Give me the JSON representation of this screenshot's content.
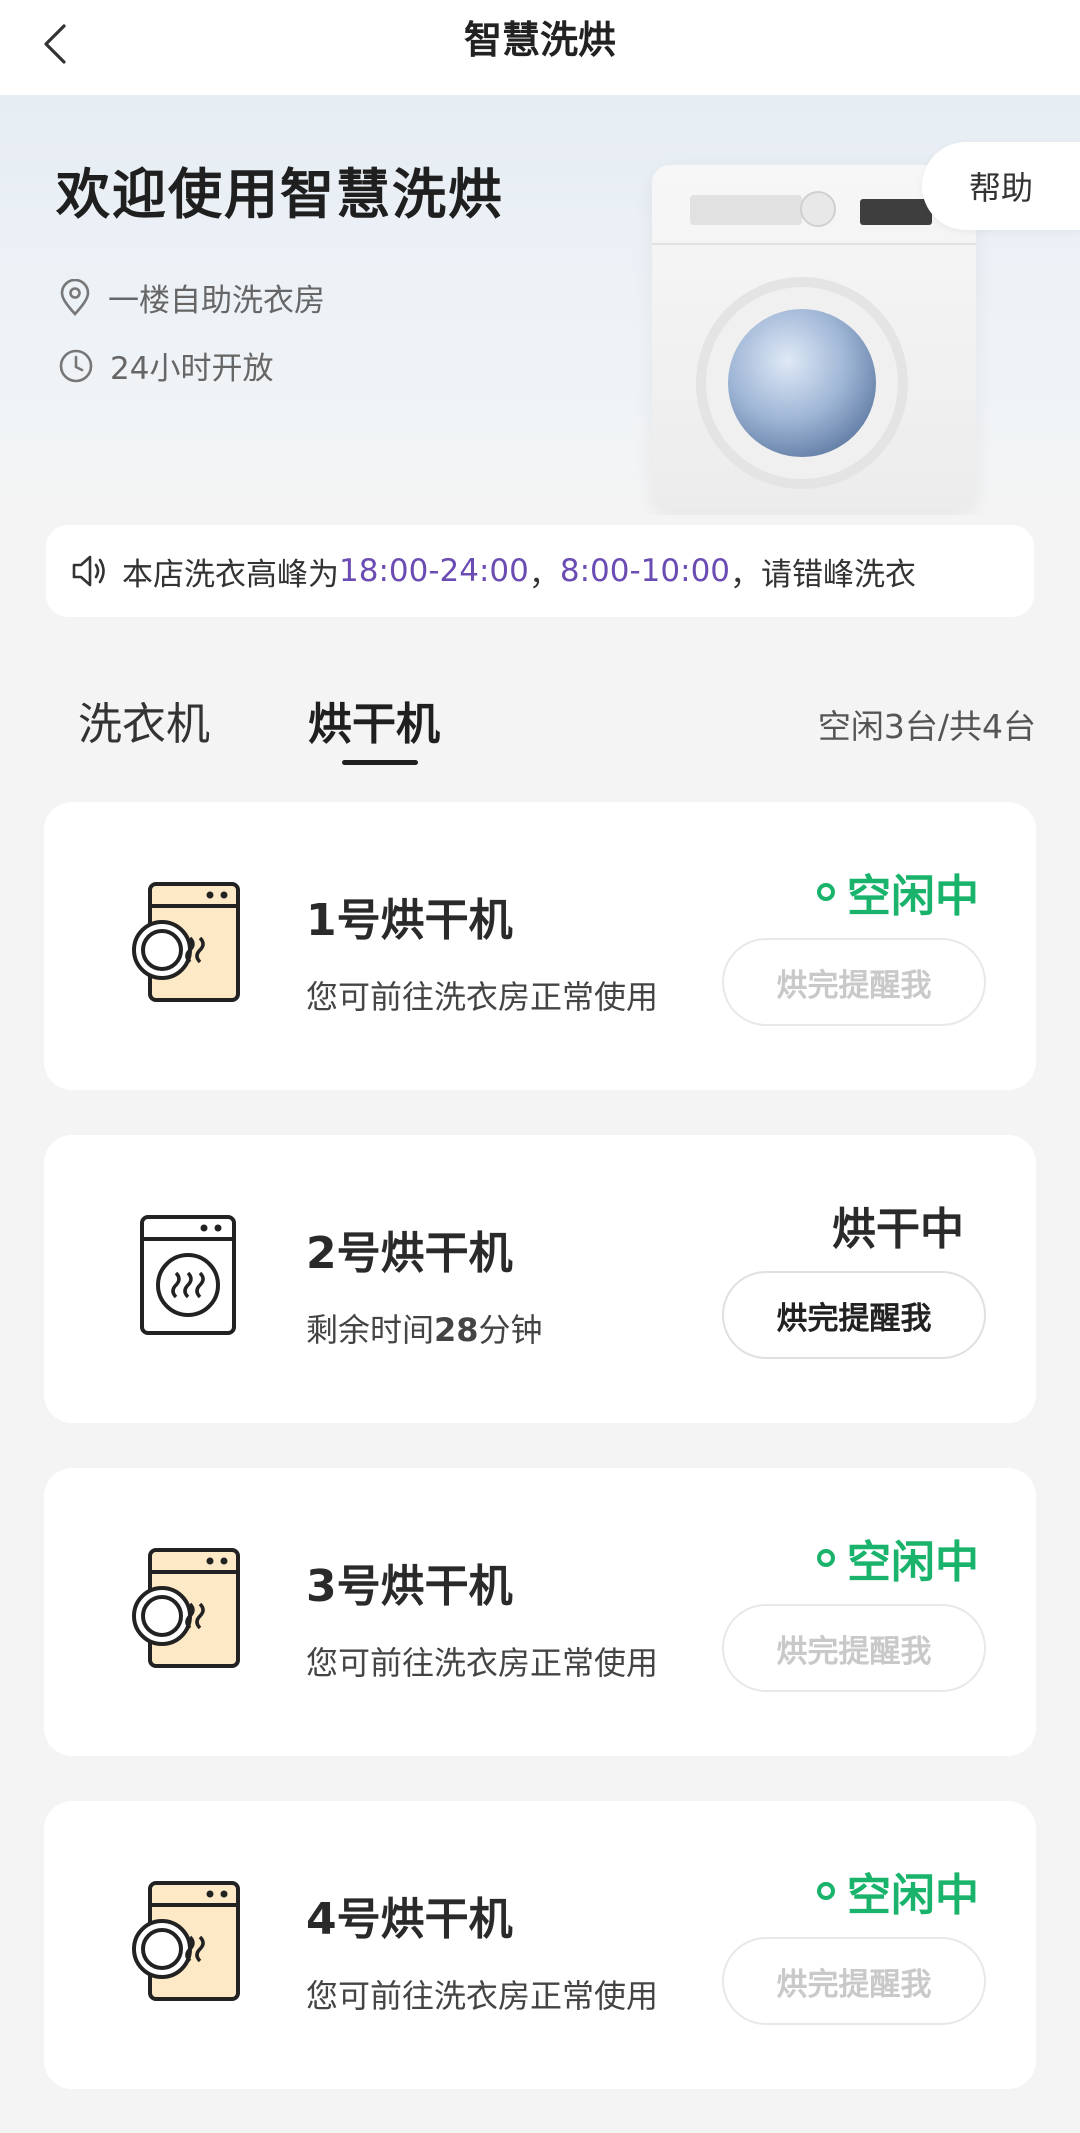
{
  "nav": {
    "title": "智慧洗烘"
  },
  "hero": {
    "title": "欢迎使用智慧洗烘",
    "location": "一楼自助洗衣房",
    "hours": "24小时开放",
    "help_label": "帮助"
  },
  "notice": {
    "prefix": "本店洗衣高峰为",
    "peak1": "18:00-24:00",
    "sep": "，",
    "peak2": "8:00-10:00",
    "suffix": "，请错峰洗衣"
  },
  "tabs": {
    "washer": "洗衣机",
    "dryer": "烘干机",
    "active": "dryer"
  },
  "count_label": "空闲3台/共4台",
  "machines": [
    {
      "name": "1号烘干机",
      "desc": "您可前往洗衣房正常使用",
      "status": "空闲中",
      "state": "idle",
      "remind": "烘完提醒我",
      "icon": "dryer-idle-icon"
    },
    {
      "name": "2号烘干机",
      "desc_prefix": "剩余时间",
      "desc_num": "28",
      "desc_suffix": "分钟",
      "status": "烘干中",
      "state": "busy",
      "remind": "烘完提醒我",
      "icon": "dryer-running-icon"
    },
    {
      "name": "3号烘干机",
      "desc": "您可前往洗衣房正常使用",
      "status": "空闲中",
      "state": "idle",
      "remind": "烘完提醒我",
      "icon": "dryer-idle-icon"
    },
    {
      "name": "4号烘干机",
      "desc": "您可前往洗衣房正常使用",
      "status": "空闲中",
      "state": "idle",
      "remind": "烘完提醒我",
      "icon": "dryer-idle-icon"
    }
  ],
  "colors": {
    "idle": "#19b36b",
    "highlight": "#6a4cb3",
    "disabled": "#c9c9c9"
  }
}
